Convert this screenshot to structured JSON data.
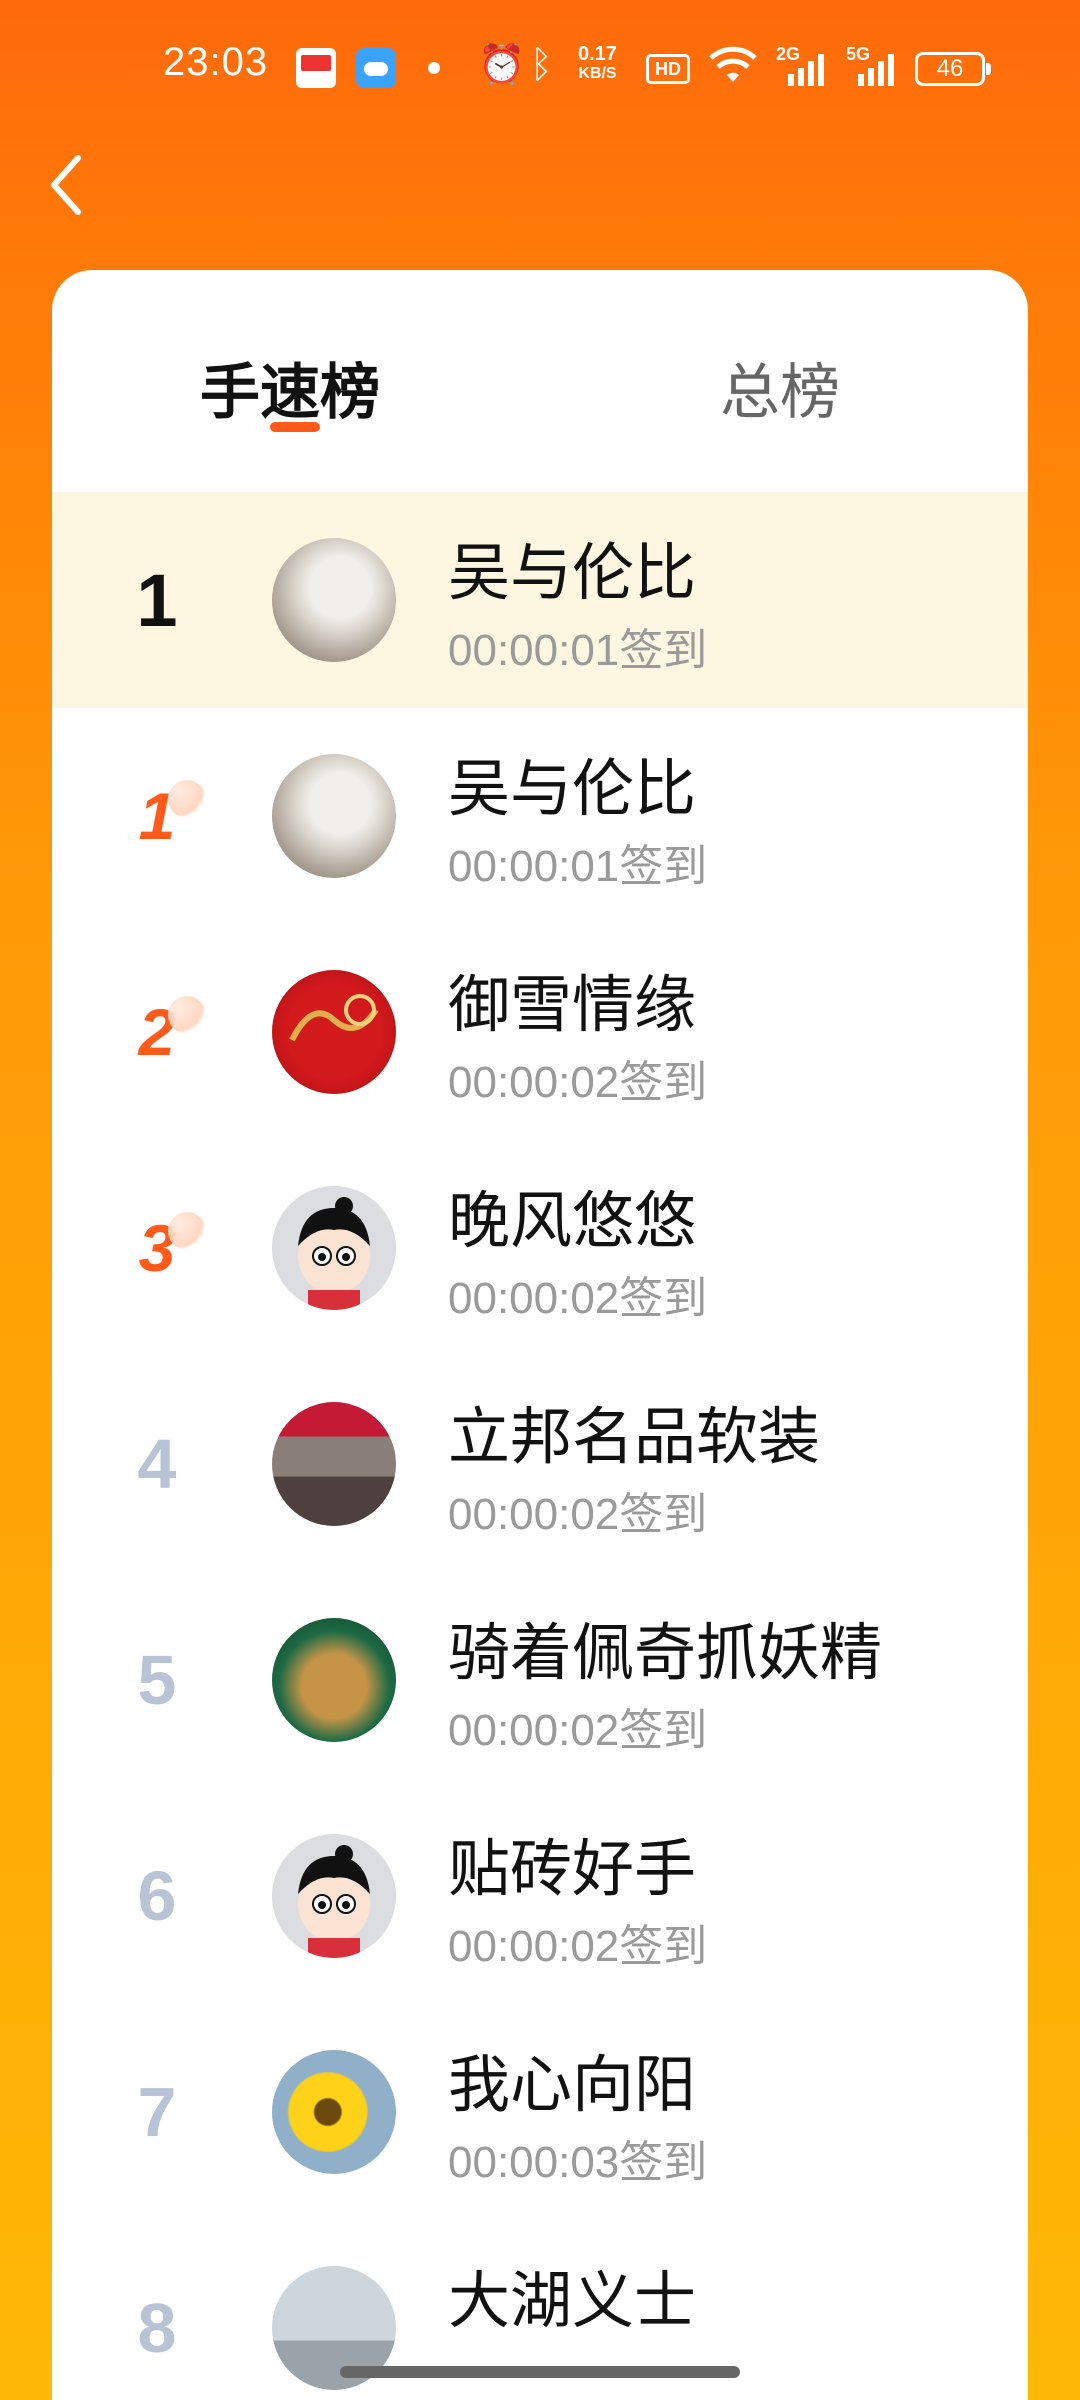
{
  "status_bar": {
    "time": "23:03",
    "speed_value": "0.17",
    "speed_unit": "KB/S",
    "hd": "HD",
    "network_1": "2G",
    "network_2": "5G",
    "battery": "46",
    "icons": [
      "toutiao-app-icon",
      "weather-app-icon",
      "notification-dot",
      "alarm-icon",
      "bluetooth-icon",
      "hd-icon",
      "wifi-icon",
      "signal-icon",
      "battery-icon"
    ]
  },
  "header": {
    "back_icon": "chevron-left-icon"
  },
  "tabs": [
    {
      "label": "手速榜",
      "active": true
    },
    {
      "label": "总榜",
      "active": false
    }
  ],
  "colors": {
    "accent": "#ff5a1a",
    "header_bg": "#ff6a0c",
    "highlight_bg": "#fdf7e1"
  },
  "my_entry": {
    "rank": "1",
    "name": "吴与伦比",
    "time": "00:00:01签到",
    "avatar": "cat-avatar"
  },
  "ranking": [
    {
      "rank": "1",
      "name": "吴与伦比",
      "time": "00:00:01签到",
      "avatar": "cat-avatar"
    },
    {
      "rank": "2",
      "name": "御雪情缘",
      "time": "00:00:02签到",
      "avatar": "red-dragon-avatar"
    },
    {
      "rank": "3",
      "name": "晚风悠悠",
      "time": "00:00:02签到",
      "avatar": "cartoon-kid-avatar"
    },
    {
      "rank": "4",
      "name": "立邦名品软装",
      "time": "00:00:02签到",
      "avatar": "storefront-avatar"
    },
    {
      "rank": "5",
      "name": "骑着佩奇抓妖精",
      "time": "00:00:02签到",
      "avatar": "buddha-avatar"
    },
    {
      "rank": "6",
      "name": "贴砖好手",
      "time": "00:00:02签到",
      "avatar": "cartoon-kid-avatar"
    },
    {
      "rank": "7",
      "name": "我心向阳",
      "time": "00:00:03签到",
      "avatar": "sunflower-avatar"
    },
    {
      "rank": "8",
      "name": "大湖义士",
      "time": "",
      "avatar": "city-tower-avatar"
    }
  ]
}
